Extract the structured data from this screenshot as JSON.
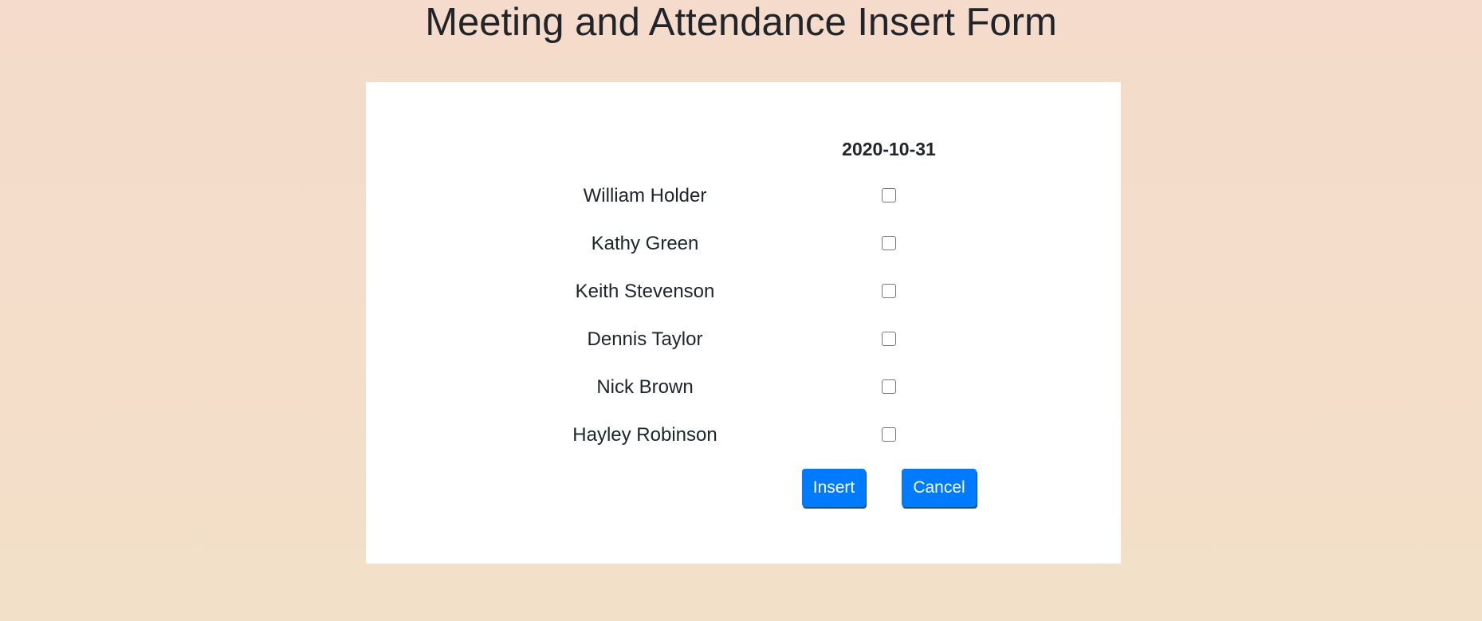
{
  "page": {
    "title": "Meeting and Attendance Insert Form"
  },
  "form": {
    "date": "2020-10-31",
    "attendees": [
      {
        "name": "William Holder",
        "checked": false
      },
      {
        "name": "Kathy Green",
        "checked": false
      },
      {
        "name": "Keith Stevenson",
        "checked": false
      },
      {
        "name": "Dennis Taylor",
        "checked": false
      },
      {
        "name": "Nick Brown",
        "checked": false
      },
      {
        "name": "Hayley Robinson",
        "checked": false
      }
    ],
    "insert_label": "Insert",
    "cancel_label": "Cancel"
  },
  "colors": {
    "background_top": "#f4dbcb",
    "background_bottom": "#f3e0c8",
    "card": "#ffffff",
    "button": "#007bff",
    "text": "#212529"
  }
}
